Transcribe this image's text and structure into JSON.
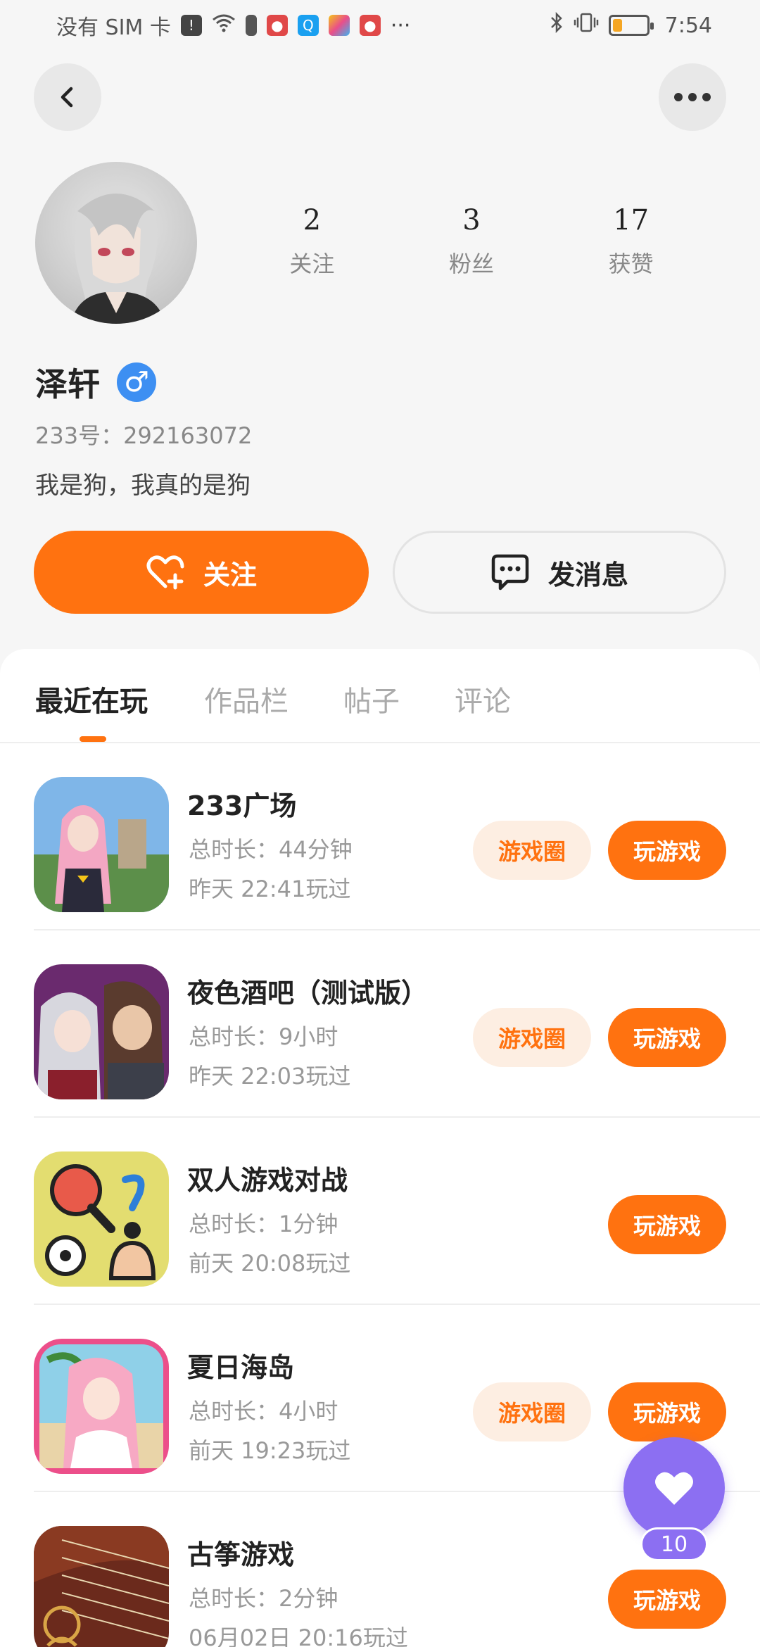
{
  "status_bar": {
    "carrier": "没有 SIM 卡",
    "time": "7:54",
    "battery_level": 0.3
  },
  "header": {
    "back_icon": "chevron-left-icon",
    "more_icon": "more-dots-icon"
  },
  "profile": {
    "username": "泽轩",
    "gender_symbol": "♂",
    "uid": "233号：292163072",
    "bio": "我是狗，我真的是狗",
    "stats": [
      {
        "value": "2",
        "label": "关注"
      },
      {
        "value": "3",
        "label": "粉丝"
      },
      {
        "value": "17",
        "label": "获赞"
      }
    ]
  },
  "actions": {
    "follow_label": "关注",
    "message_label": "发消息"
  },
  "tabs": [
    {
      "label": "最近在玩",
      "active": true
    },
    {
      "label": "作品栏",
      "active": false
    },
    {
      "label": "帖子",
      "active": false
    },
    {
      "label": "评论",
      "active": false
    }
  ],
  "games": [
    {
      "title": "233广场",
      "duration": "总时长：44分钟",
      "last_played": "昨天 22:41玩过",
      "has_circle": true,
      "circle_label": "游戏圈",
      "play_label": "玩游戏"
    },
    {
      "title": "夜色酒吧（测试版）",
      "duration": "总时长：9小时",
      "last_played": "昨天 22:03玩过",
      "has_circle": true,
      "circle_label": "游戏圈",
      "play_label": "玩游戏"
    },
    {
      "title": "双人游戏对战",
      "duration": "总时长：1分钟",
      "last_played": "前天 20:08玩过",
      "has_circle": false,
      "circle_label": "",
      "play_label": "玩游戏"
    },
    {
      "title": "夏日海岛",
      "duration": "总时长：4小时",
      "last_played": "前天 19:23玩过",
      "has_circle": true,
      "circle_label": "游戏圈",
      "play_label": "玩游戏"
    },
    {
      "title": "古筝游戏",
      "duration": "总时长：2分钟",
      "last_played": "06月02日 20:16玩过",
      "has_circle": false,
      "circle_label": "",
      "play_label": "玩游戏"
    }
  ],
  "like_float": {
    "count": "10"
  },
  "colors": {
    "accent": "#ff7210",
    "accent_light": "#fdeee2",
    "gender_blue": "#3d8ff2",
    "like_purple": "#8c6ff2"
  }
}
